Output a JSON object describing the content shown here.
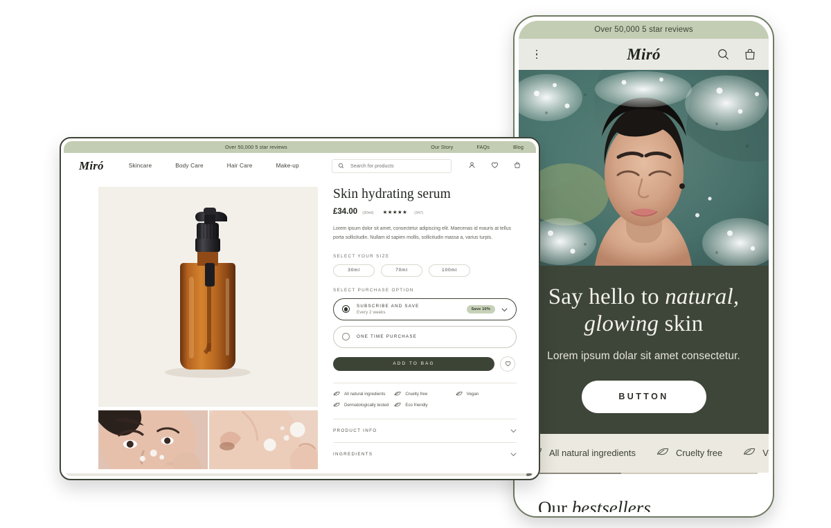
{
  "tablet": {
    "announcement": "Over 50,000 5 star reviews",
    "logo": "Miró",
    "icons": {
      "menu": "kebab-menu-icon",
      "search": "search-icon",
      "bag": "shopping-bag-icon"
    },
    "hero": {
      "headline_1": "Say hello to ",
      "headline_1_em": "natural,",
      "headline_2_em": "glowing",
      "headline_2": " skin",
      "subtitle": "Lorem ipsum dolar sit amet consectetur.",
      "button": "BUTTON"
    },
    "features": [
      {
        "icon": "leaf-icon",
        "label": "All natural ingredients"
      },
      {
        "icon": "leaf-icon",
        "label": "Cruelty free"
      },
      {
        "icon": "leaf-icon",
        "label": "Vegan"
      }
    ],
    "bestsellers_pre": "Our ",
    "bestsellers_em": "bestsellers"
  },
  "laptop": {
    "announcement": "Over 50,000 5 star reviews",
    "top_links": [
      "Our Story",
      "FAQs",
      "Blog"
    ],
    "logo": "Miró",
    "nav": [
      "Skincare",
      "Body Care",
      "Hair Care",
      "Make-up"
    ],
    "search_placeholder": "Search for products",
    "header_icons": {
      "account": "user-account-icon",
      "wishlist": "heart-icon",
      "bag": "shopping-bag-icon"
    },
    "product": {
      "title": "Skin hydrating serum",
      "price": "£34.00",
      "size_note": "(30ml)",
      "stars": "★★★★★",
      "review_count": "(347)",
      "description": "Lorem ipsum dolor sit amet, consectetur adipiscing elit. Maecenas id mauris at tellus porta sollicitudin. Nullam id sapien mollis, sollicitudin massa a, varius turpis.",
      "size_label": "SELECT YOUR SIZE",
      "sizes": [
        "30ml",
        "70ml",
        "100ml"
      ],
      "selected_size": "30ml",
      "purchase_label": "SELECT PURCHASE OPTION",
      "options": [
        {
          "title": "SUBSCRIBE AND SAVE",
          "subtitle": "Every 2 weeks",
          "badge": "Save 10%",
          "selected": true
        },
        {
          "title": "ONE TIME PURCHASE",
          "subtitle": "",
          "badge": "",
          "selected": false
        }
      ],
      "add_to_bag": "ADD TO BAG",
      "wishlist_icon": "heart-icon",
      "features": [
        {
          "icon": "leaf-icon",
          "label": "All natural ingredients"
        },
        {
          "icon": "leaf-icon",
          "label": "Cruelty free"
        },
        {
          "icon": "leaf-icon",
          "label": "Vegan"
        },
        {
          "icon": "leaf-icon",
          "label": "Dermatologically tested"
        },
        {
          "icon": "leaf-icon",
          "label": "Eco friendly"
        }
      ],
      "accordions": [
        "PRODUCT INFO",
        "INGREDIENTS"
      ]
    }
  },
  "colors": {
    "sage": "#c3cdb4",
    "dark_green": "#3e4539",
    "cream": "#ece9e0",
    "product_bg": "#f3f0ea",
    "badge_green": "#c7d1b8"
  }
}
